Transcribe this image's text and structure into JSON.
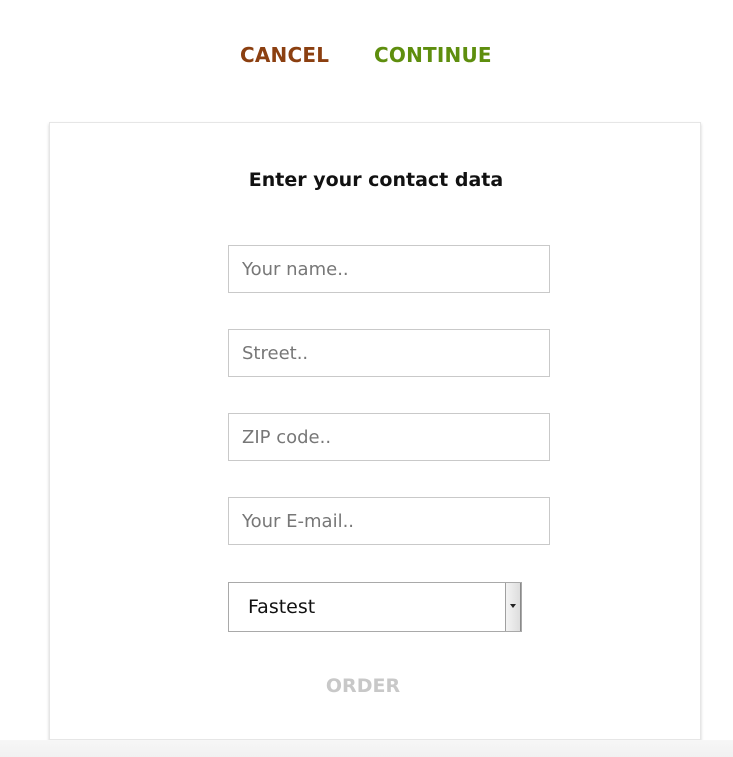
{
  "top_actions": {
    "cancel_label": "CANCEL",
    "continue_label": "CONTINUE",
    "cancel_color": "#8b3f10",
    "continue_color": "#5e8e0e"
  },
  "form": {
    "title": "Enter your contact data",
    "name_placeholder": "Your name..",
    "street_placeholder": "Street..",
    "zip_placeholder": "ZIP code..",
    "email_placeholder": "Your E-mail..",
    "shipping_selected": "Fastest",
    "order_label": "ORDER",
    "order_disabled_color": "#c8c8c8"
  }
}
